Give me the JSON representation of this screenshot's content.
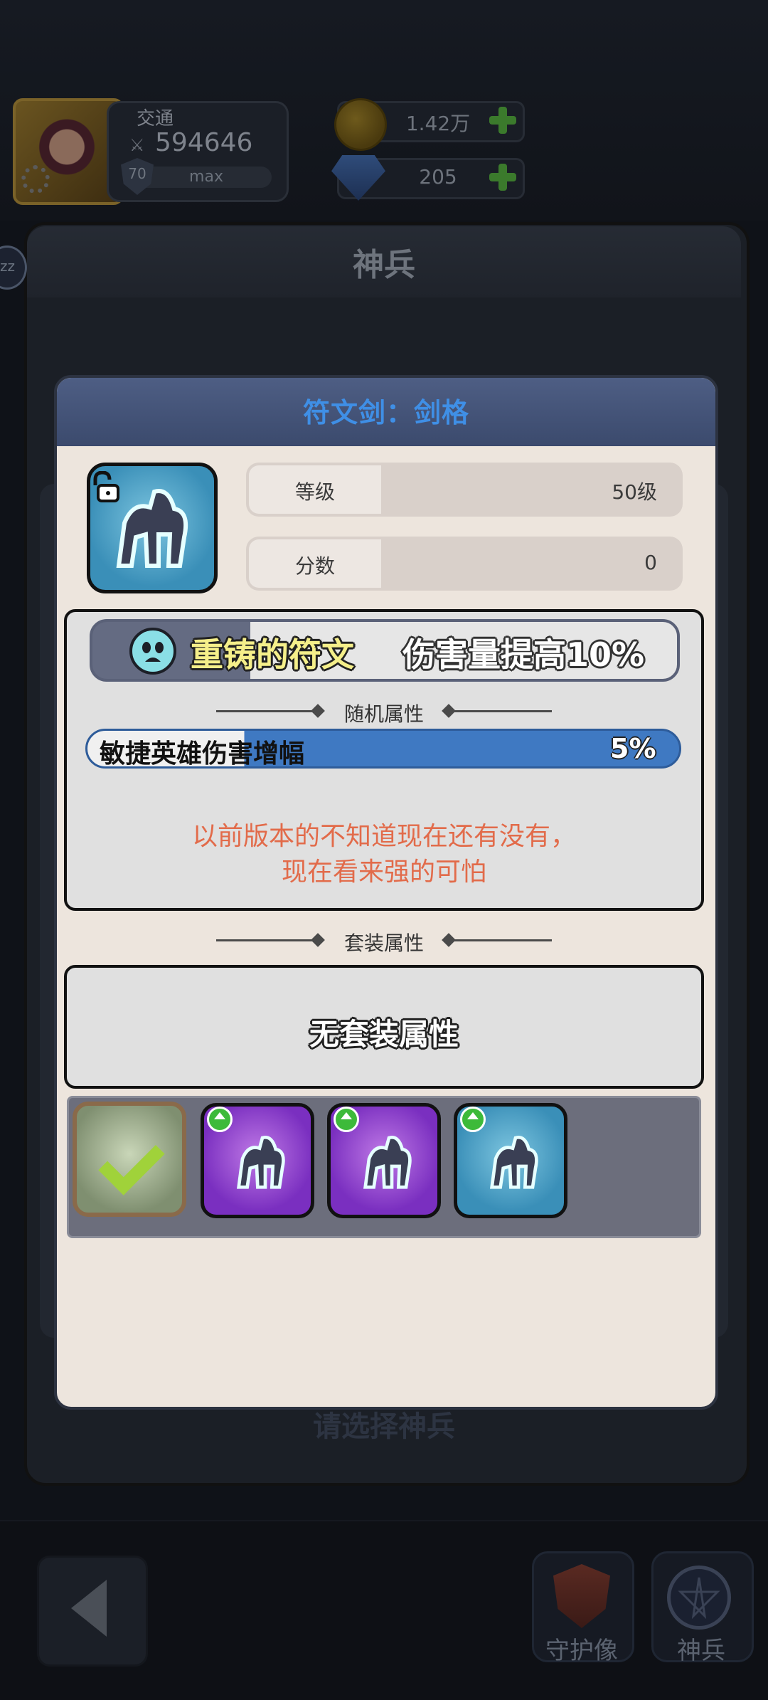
{
  "player": {
    "name": "交通",
    "power": "594646",
    "level": "70",
    "level_status": "max"
  },
  "resources": {
    "gold": "1.42万",
    "gems": "205"
  },
  "page": {
    "title": "神兵",
    "select_hint": "请选择神兵",
    "side_badge": "zz"
  },
  "nav": {
    "guardian_label": "守护像",
    "weapon_label": "神兵"
  },
  "modal": {
    "title": "符文剑：剑格",
    "stats": [
      {
        "label": "等级",
        "value": "50级"
      },
      {
        "label": "分数",
        "value": "0"
      }
    ],
    "rune": {
      "name": "重铸的符文",
      "effect": "伤害量提高10%"
    },
    "random_attr": {
      "heading": "随机属性",
      "name": "敏捷英雄伤害增幅",
      "value": "5%"
    },
    "note_lines": [
      "以前版本的不知道现在还有没有，",
      "现在看来强的可怕"
    ],
    "set_attr": {
      "heading": "套装属性",
      "text": "无套装属性"
    },
    "slots": [
      {
        "style": "selected",
        "upgrade": false
      },
      {
        "style": "purple",
        "upgrade": true
      },
      {
        "style": "purple",
        "upgrade": true
      },
      {
        "style": "blue",
        "upgrade": true
      }
    ]
  },
  "colors": {
    "accent_blue": "#3f8fe6",
    "note_red": "#e26b4a",
    "bar_blue": "#3f79c2"
  }
}
